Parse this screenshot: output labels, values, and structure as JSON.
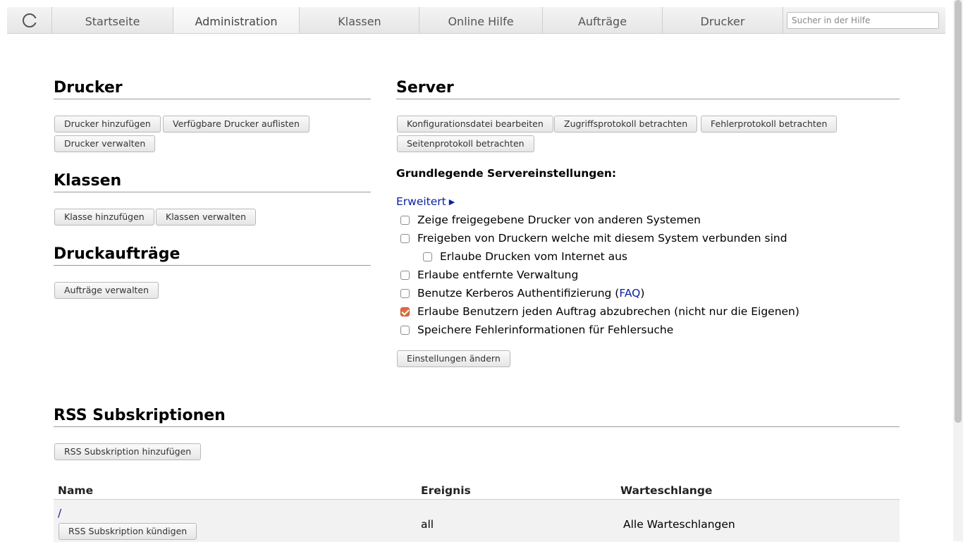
{
  "nav": {
    "tabs": [
      "Startseite",
      "Administration",
      "Klassen",
      "Online Hilfe",
      "Aufträge",
      "Drucker"
    ],
    "active": "Administration",
    "search_placeholder": "Sucher in der Hilfe"
  },
  "printers": {
    "heading": "Drucker",
    "buttons": [
      "Drucker hinzufügen",
      "Verfügbare Drucker auflisten",
      "Drucker verwalten"
    ]
  },
  "classes": {
    "heading": "Klassen",
    "buttons": [
      "Klasse hinzufügen",
      "Klassen verwalten"
    ]
  },
  "jobs": {
    "heading": "Druckaufträge",
    "buttons": [
      "Aufträge verwalten"
    ]
  },
  "server": {
    "heading": "Server",
    "buttons": [
      "Konfigurationsdatei bearbeiten",
      "Zugriffsprotokoll betrachten",
      "Fehlerprotokoll betrachten",
      "Seitenprotokoll betrachten"
    ],
    "settings_label": "Grundlegende Servereinstellungen:",
    "advanced_link": "Erweitert",
    "options": [
      {
        "label": "Zeige freigegebene Drucker von anderen Systemen",
        "checked": false
      },
      {
        "label": "Freigeben von Druckern welche mit diesem System verbunden sind",
        "checked": false
      },
      {
        "label": "Erlaube Drucken vom Internet aus",
        "checked": false
      },
      {
        "label": "Erlaube entfernte Verwaltung",
        "checked": false
      },
      {
        "label": "Benutze Kerberos Authentifizierung (",
        "link": "FAQ",
        "suffix": ")",
        "checked": false
      },
      {
        "label": "Erlaube Benutzern jeden Auftrag abzubrechen (nicht nur die Eigenen)",
        "checked": true
      },
      {
        "label": "Speichere Fehlerinformationen für Fehlersuche",
        "checked": false
      }
    ],
    "apply_button": "Einstellungen ändern"
  },
  "rss": {
    "heading": "RSS Subskriptionen",
    "add_button": "RSS Subskription hinzufügen",
    "columns": [
      "Name",
      "Ereignis",
      "Warteschlange"
    ],
    "rows": [
      {
        "name": "/",
        "cancel_button": "RSS Subskription kündigen",
        "event": "all",
        "queue": "Alle Warteschlangen"
      }
    ]
  },
  "colors": {
    "accent_checkbox": "#e06b3b",
    "link": "#0b1fa0"
  }
}
